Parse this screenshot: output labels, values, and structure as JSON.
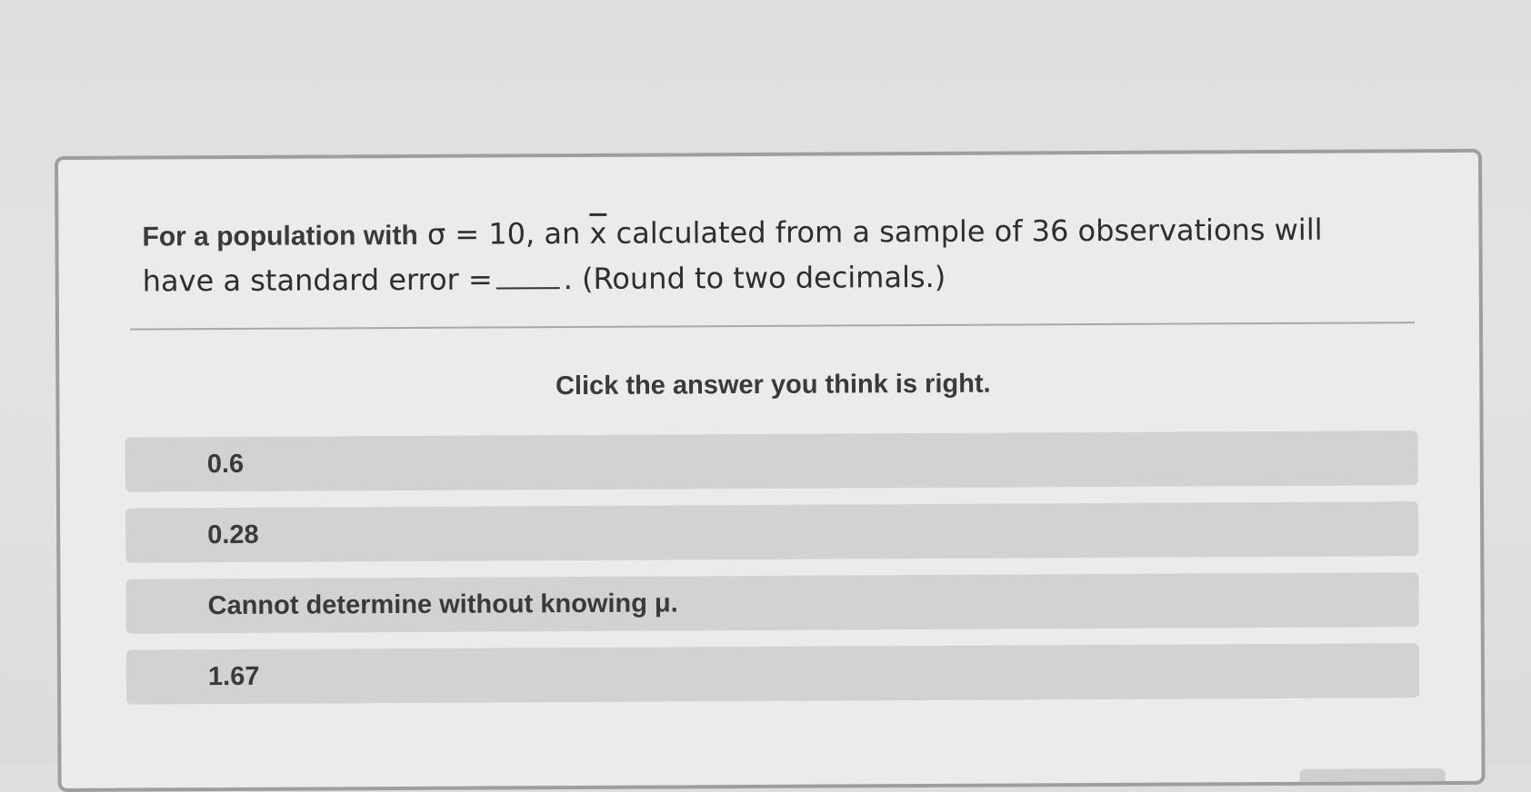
{
  "question": {
    "lead": "For a population with",
    "sigma_eq": "σ = 10, an",
    "xbar": "x",
    "rest_line1": "calculated from a sample of 36 observations will",
    "line2_start": "have a standard error =",
    "line2_end": ". (Round to two decimals.)"
  },
  "instruction": "Click the answer you think is right.",
  "options": [
    {
      "label": "0.6"
    },
    {
      "label": "0.28"
    },
    {
      "label": "Cannot determine without knowing μ."
    },
    {
      "label": "1.67"
    }
  ]
}
